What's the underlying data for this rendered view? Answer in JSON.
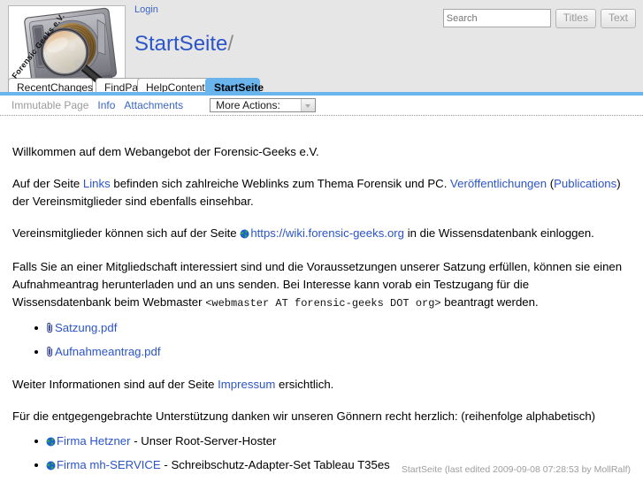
{
  "header": {
    "logo": {
      "caption": "Forensic Geeks e.V.",
      "alt": "hard-disk-with-magnifier-logo"
    },
    "login_label": "Login",
    "page_title": "StartSeite",
    "page_title_separator": "/",
    "search": {
      "placeholder": "Search",
      "value": "",
      "titles_button": "Titles",
      "text_button": "Text"
    }
  },
  "tabs": [
    {
      "label": "RecentChanges",
      "active": false
    },
    {
      "label": "FindPage",
      "active": false
    },
    {
      "label": "HelpContents",
      "active": false
    },
    {
      "label": "StartSeite",
      "active": true
    }
  ],
  "actionbar": {
    "immutable_label": "Immutable Page",
    "info_label": "Info",
    "attachments_label": "Attachments",
    "more_actions_label": "More Actions:"
  },
  "content": {
    "p1": "Willkommen auf dem Webangebot der Forensic-Geeks e.V.",
    "p2": {
      "t1": "Auf der Seite ",
      "link_links": "Links",
      "t2": " befinden sich zahlreiche Weblinks zum Thema Forensik und PC. ",
      "link_veroeff": "Veröffentlichungen",
      "t3": " (",
      "link_publications": "Publications",
      "t4": ") der Vereinsmitglieder sind ebenfalls einsehbar."
    },
    "p3": {
      "t1": "Vereinsmitglieder können sich auf der Seite ",
      "link_wiki": "https://wiki.forensic-geeks.org",
      "t2": " in die Wissensdatenbank einloggen."
    },
    "p4": {
      "t1": "Falls Sie an einer Mitgliedschaft interessiert sind und die Voraussetzungen unserer Satzung erfüllen, können sie einen Aufnahmeantrag herunterladen und an uns senden. Bei Interesse kann vorab ein Testzugang für die Wissensdatenbank beim Webmaster ",
      "email": "<webmaster AT forensic-geeks DOT org>",
      "t2": " beantragt werden."
    },
    "attachments": [
      {
        "label": "Satzung.pdf"
      },
      {
        "label": "Aufnahmeantrag.pdf"
      }
    ],
    "p5": {
      "t1": "Weiter Informationen sind auf der Seite ",
      "link_impressum": "Impressum",
      "t2": " ersichtlich."
    },
    "p6": "Für die entgegengebrachte Unterstützung danken wir unseren Gönnern recht herzlich: (reihenfolge alphabetisch)",
    "sponsors": [
      {
        "link": "Firma Hetzner",
        "desc": " - Unser Root-Server-Hoster"
      },
      {
        "link": "Firma mh-SERVICE",
        "desc": " - Schreibschutz-Adapter-Set Tableau T35es"
      }
    ]
  },
  "footer": {
    "text": "StartSeite (last edited 2009-09-08 07:28:53 by MollRalf)"
  },
  "colors": {
    "link": "#2b55c8",
    "accent_blue": "#6ab4ee",
    "header_bg": "#e6e6e6",
    "muted": "#9b9b9b"
  }
}
